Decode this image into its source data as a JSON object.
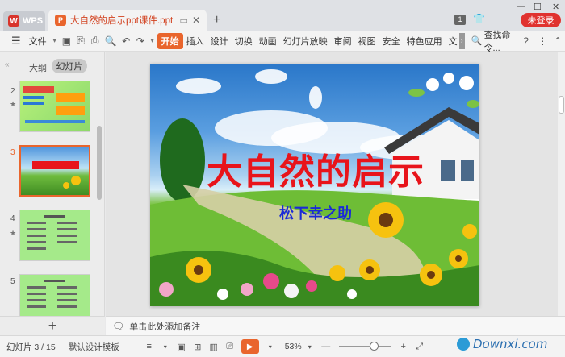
{
  "app": {
    "name": "WPS"
  },
  "document": {
    "name": "大自然的启示ppt课件.ppt"
  },
  "titlebar": {
    "badge": "1",
    "login": "未登录"
  },
  "menu": {
    "file": "文件",
    "tabs": [
      "开始",
      "插入",
      "设计",
      "切换",
      "动画",
      "幻灯片放映",
      "审阅",
      "视图",
      "安全",
      "特色应用",
      "文"
    ],
    "search": "查找命令..."
  },
  "leftpanel": {
    "tab_outline": "大纲",
    "tab_slides": "幻灯片",
    "thumbnails": [
      {
        "number": "2",
        "selected": false
      },
      {
        "number": "3",
        "selected": true
      },
      {
        "number": "4",
        "selected": false
      },
      {
        "number": "5",
        "selected": false
      }
    ]
  },
  "slide": {
    "title": "大自然的启示",
    "subtitle": "松下幸之助",
    "colors": {
      "title": "#e8141b",
      "subtitle": "#1b2ad6"
    }
  },
  "notes": {
    "placeholder": "单击此处添加备注"
  },
  "status": {
    "slide_counter": "幻灯片 3 / 15",
    "template": "默认设计模板",
    "zoom": "53%"
  },
  "watermark": {
    "text": "Downxi.com"
  },
  "colors": {
    "accent": "#e9652d",
    "login": "#e0322f"
  }
}
